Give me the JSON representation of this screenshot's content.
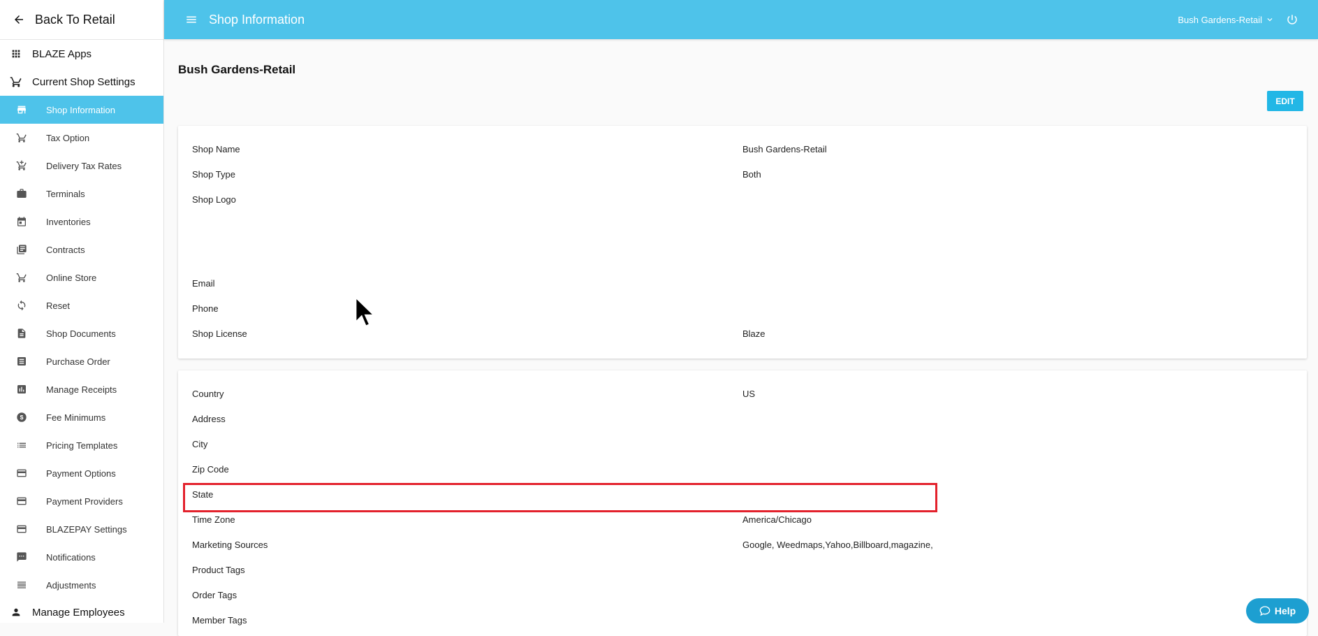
{
  "sidebar": {
    "back_label": "Back To Retail",
    "sections": {
      "apps": "BLAZE Apps",
      "shop_settings": "Current Shop Settings",
      "employees": "Manage Employees"
    },
    "items": [
      {
        "label": "Shop Information",
        "icon": "store-icon"
      },
      {
        "label": "Tax Option",
        "icon": "cart-icon"
      },
      {
        "label": "Delivery Tax Rates",
        "icon": "cart-plus-icon"
      },
      {
        "label": "Terminals",
        "icon": "briefcase-icon"
      },
      {
        "label": "Inventories",
        "icon": "calendar-icon"
      },
      {
        "label": "Contracts",
        "icon": "library-icon"
      },
      {
        "label": "Online Store",
        "icon": "cart-icon"
      },
      {
        "label": "Reset",
        "icon": "refresh-icon"
      },
      {
        "label": "Shop Documents",
        "icon": "document-icon"
      },
      {
        "label": "Purchase Order",
        "icon": "list-icon"
      },
      {
        "label": "Manage Receipts",
        "icon": "chart-icon"
      },
      {
        "label": "Fee Minimums",
        "icon": "dollar-icon"
      },
      {
        "label": "Pricing Templates",
        "icon": "list-icon"
      },
      {
        "label": "Payment Options",
        "icon": "credit-card-icon"
      },
      {
        "label": "Payment Providers",
        "icon": "credit-card-icon"
      },
      {
        "label": "BLAZEPAY Settings",
        "icon": "credit-card-icon"
      },
      {
        "label": "Notifications",
        "icon": "message-icon"
      },
      {
        "label": "Adjustments",
        "icon": "lines-icon"
      }
    ]
  },
  "topbar": {
    "title": "Shop Information",
    "shop_selector": "Bush Gardens-Retail",
    "accent": "#4ec3ea"
  },
  "main": {
    "title": "Bush Gardens-Retail",
    "edit_label": "EDIT",
    "card1": [
      {
        "label": "Shop Name",
        "value": "Bush Gardens-Retail"
      },
      {
        "label": "Shop Type",
        "value": "Both"
      },
      {
        "label": "Shop Logo",
        "value": ""
      },
      {
        "label": "Email",
        "value": ""
      },
      {
        "label": "Phone",
        "value": ""
      },
      {
        "label": "Shop License",
        "value": "Blaze"
      }
    ],
    "card2": [
      {
        "label": "Country",
        "value": "US"
      },
      {
        "label": "Address",
        "value": ""
      },
      {
        "label": "City",
        "value": ""
      },
      {
        "label": "Zip Code",
        "value": ""
      },
      {
        "label": "State",
        "value": ""
      },
      {
        "label": "Time Zone",
        "value": "America/Chicago"
      },
      {
        "label": "Marketing Sources",
        "value": "Google, Weedmaps,Yahoo,Billboard,magazine,"
      },
      {
        "label": "Product Tags",
        "value": ""
      },
      {
        "label": "Order Tags",
        "value": ""
      },
      {
        "label": "Member Tags",
        "value": ""
      }
    ]
  },
  "help_label": "Help",
  "highlight_color": "#e3212c"
}
